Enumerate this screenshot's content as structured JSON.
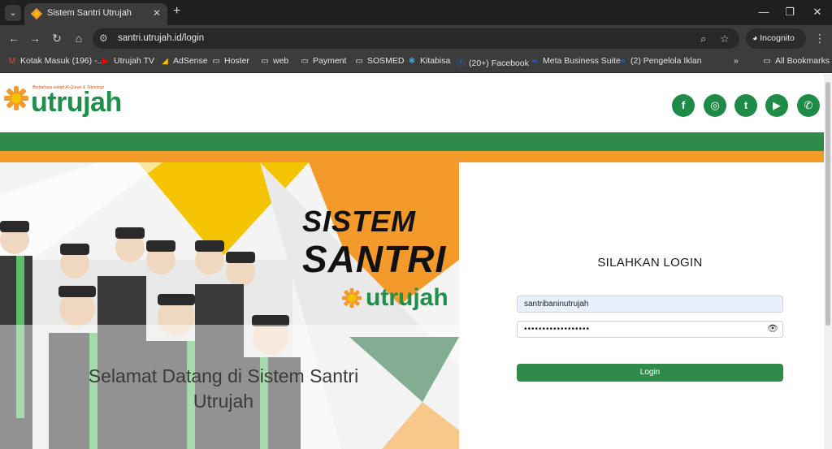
{
  "browser": {
    "tab_title": "Sistem Santri Utrujah",
    "url": "santri.utrujah.id/login",
    "incognito_label": "Incognito",
    "bookmarks": [
      {
        "label": "Kotak Masuk (196) -...",
        "icon": "gmail-icon"
      },
      {
        "label": "Utrujah TV",
        "icon": "youtube-icon"
      },
      {
        "label": "AdSense",
        "icon": "adsense-icon"
      },
      {
        "label": "Hoster",
        "icon": "folder-icon"
      },
      {
        "label": "web",
        "icon": "folder-icon"
      },
      {
        "label": "Payment",
        "icon": "folder-icon"
      },
      {
        "label": "SOSMED",
        "icon": "folder-icon"
      },
      {
        "label": "Kitabisa",
        "icon": "kitabisa-icon"
      },
      {
        "label": "(20+) Facebook",
        "icon": "facebook-icon"
      },
      {
        "label": "Meta Business Suite",
        "icon": "meta-icon"
      },
      {
        "label": "(2) Pengelola Iklan",
        "icon": "meta-icon"
      }
    ],
    "all_bookmarks_label": "All Bookmarks"
  },
  "header": {
    "logo_word": "utrujah",
    "logo_tagline": "Berbahasa sebab Al-Quran & Teknologi",
    "social": [
      {
        "name": "facebook",
        "glyph": "f"
      },
      {
        "name": "instagram",
        "glyph": "◎"
      },
      {
        "name": "twitter",
        "glyph": "t"
      },
      {
        "name": "youtube",
        "glyph": "▶"
      },
      {
        "name": "whatsapp",
        "glyph": "✆"
      }
    ]
  },
  "hero": {
    "poster_line1": "SISTEM",
    "poster_line2": "SANTRI",
    "poster_logo": "utrujah",
    "welcome_line1": "Selamat Datang di Sistem Santri",
    "welcome_line2": "Utrujah"
  },
  "login": {
    "title": "SILAHKAN LOGIN",
    "username_value": "santribaninutrujah",
    "password_mask": "••••••••••••••••••",
    "button_label": "Login"
  },
  "colors": {
    "brand_green": "#2e8b4a",
    "brand_orange": "#f39a2b",
    "brand_yellow": "#f5c400"
  }
}
